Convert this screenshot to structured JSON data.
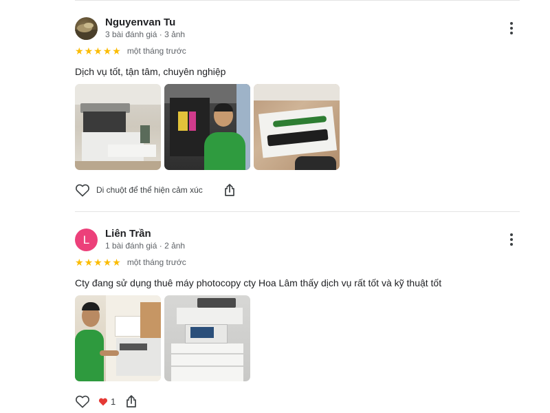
{
  "reviews": [
    {
      "author": "Nguyenvan Tu",
      "meta": "3 bài đánh giá · 3 ảnh",
      "avatar_type": "photo",
      "rating": 5,
      "time": "một tháng trước",
      "text": "Dịch vụ tốt, tận tâm, chuyên nghiệp",
      "photos": [
        "office-copier-photo",
        "technician-green-shirt-photo",
        "toner-parts-photo"
      ],
      "reaction_hint": "Di chuột để thể hiện cảm xúc"
    },
    {
      "author": "Liên Trần",
      "meta": "1 bài đánh giá · 2 ảnh",
      "avatar_letter": "L",
      "avatar_color": "#ec407a",
      "rating": 5,
      "time": "một tháng trước",
      "text": "Cty đang sử dụng thuê máy photocopy cty Hoa Lâm thấy dịch vụ rất tốt và kỹ thuật tốt",
      "photos": [
        "technician-at-copier-photo",
        "copier-machine-photo"
      ],
      "reaction_count": "1",
      "reaction_icon": "red-heart-icon"
    }
  ],
  "colors": {
    "star": "#fbbc04",
    "text": "#202124",
    "secondary": "#5f6368",
    "divider": "#e3e3e3",
    "heart": "#e53935"
  }
}
